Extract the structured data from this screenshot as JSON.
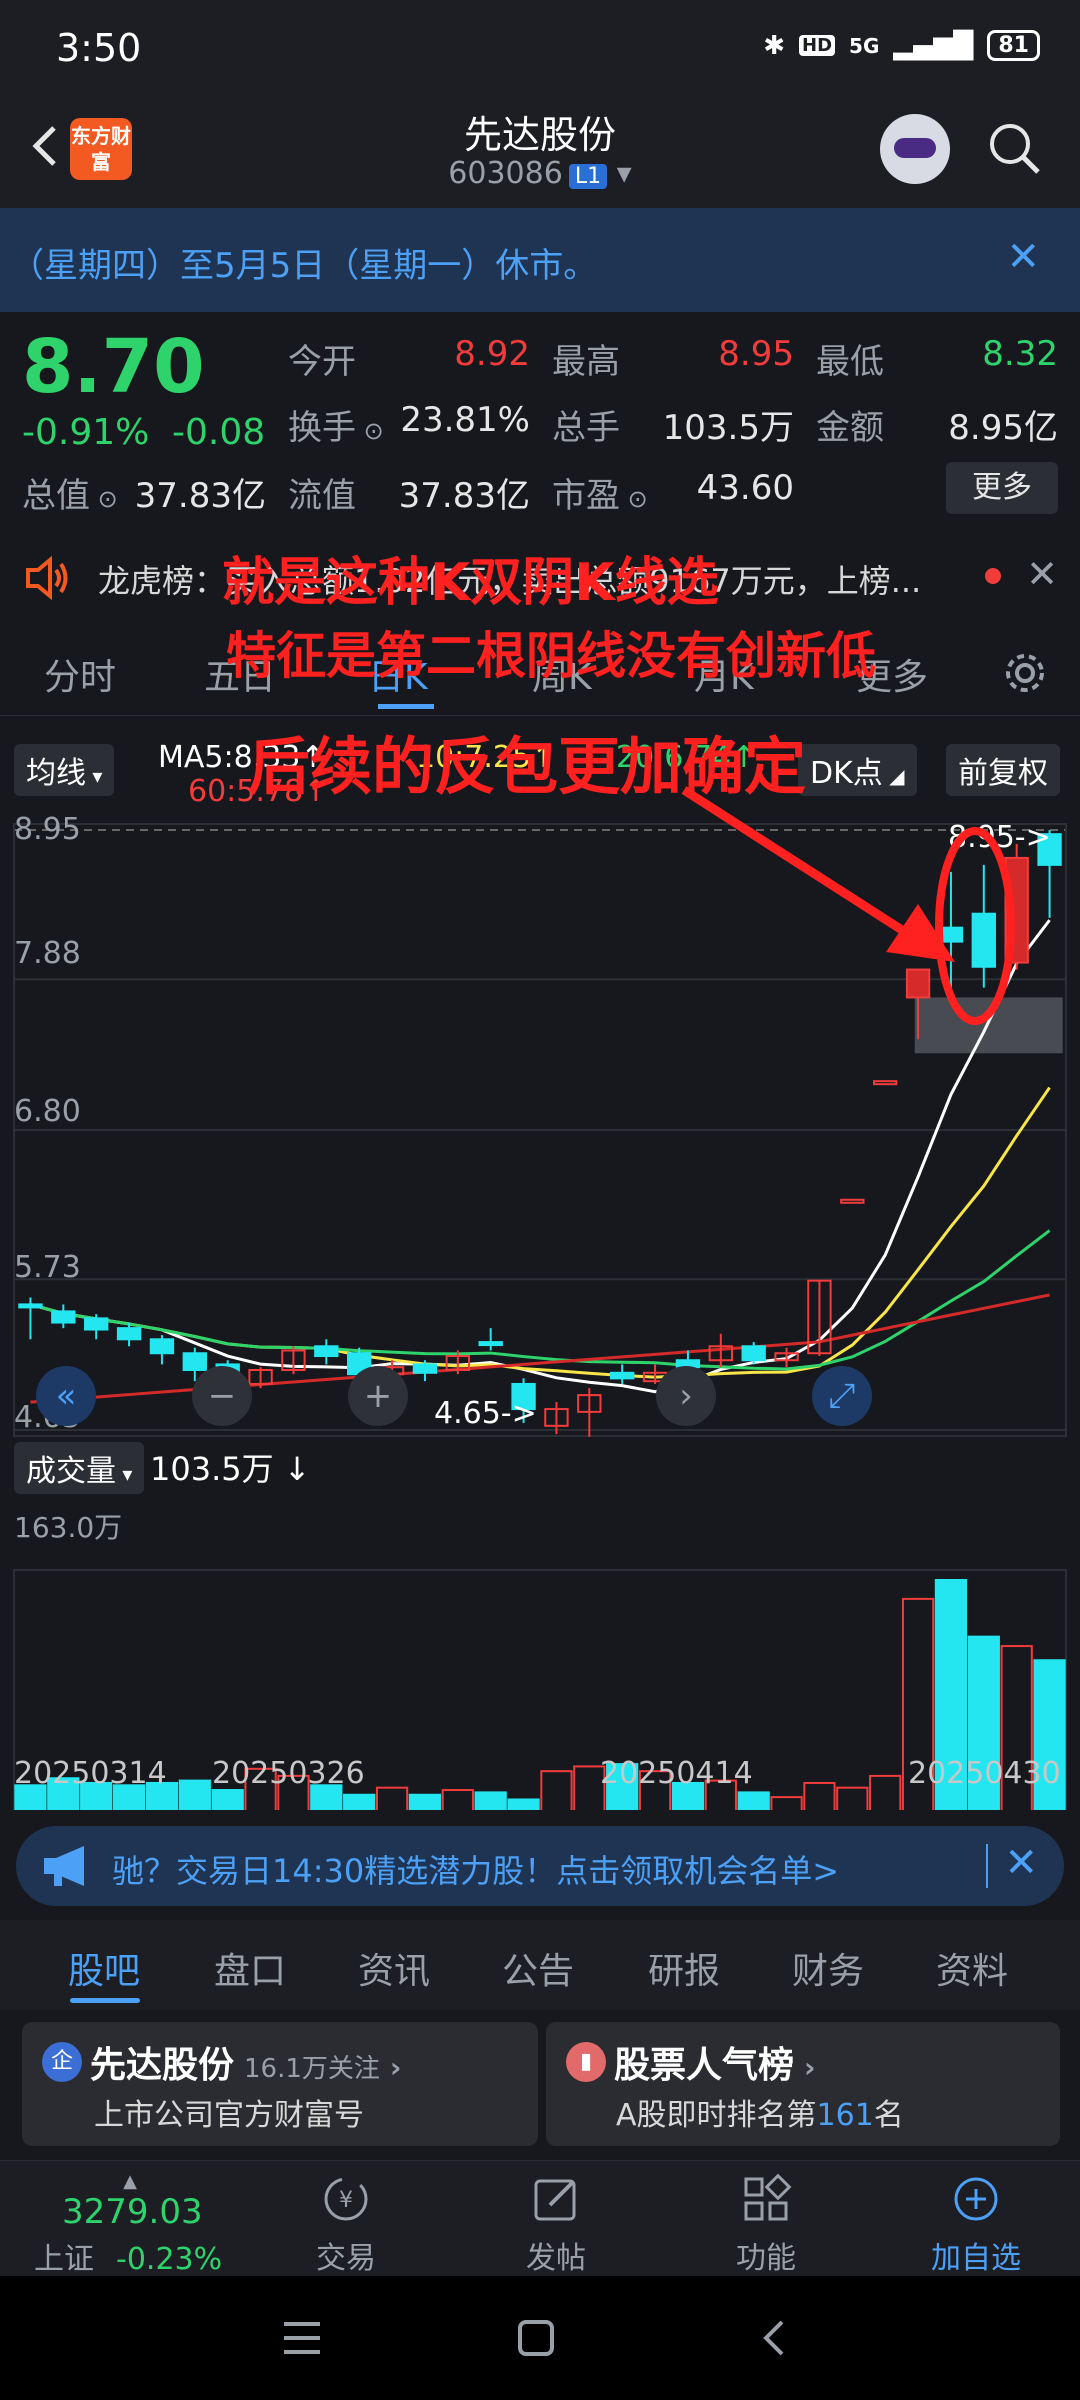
{
  "status": {
    "time": "3:50",
    "hd": "HD",
    "signal": "5G",
    "battery": "81"
  },
  "header": {
    "logo": "东方财富",
    "title": "先达股份",
    "code": "603086",
    "level": "L1"
  },
  "notice": {
    "text": "（星期四）至5月5日（星期一）休市。",
    "close": "✕"
  },
  "quote": {
    "price": "8.70",
    "pct": "-0.91%",
    "chg": "-0.08",
    "rows": [
      [
        {
          "label": "今开",
          "value": "8.92",
          "color": "red"
        },
        {
          "label": "最高",
          "value": "8.95",
          "color": "red"
        },
        {
          "label": "最低",
          "value": "8.32",
          "color": "green"
        }
      ],
      [
        {
          "label": "换手",
          "value": "23.81%",
          "color": "white"
        },
        {
          "label": "总手",
          "value": "103.5万",
          "color": "white"
        },
        {
          "label": "金额",
          "value": "8.95亿",
          "color": "white"
        }
      ],
      [
        {
          "label": "总值",
          "value": "37.83亿",
          "color": "white"
        },
        {
          "label": "流值",
          "value": "37.83亿",
          "color": "white"
        },
        {
          "label": "市盈",
          "value": "43.60",
          "color": "white"
        }
      ]
    ],
    "more": "更多"
  },
  "lhb": {
    "text": "龙虎榜：买入总额1.02亿元，卖出总额9167万元，上榜..."
  },
  "ktabs": [
    "分时",
    "五日",
    "日K",
    "周K",
    "月K",
    "更多"
  ],
  "annotations": [
    "就是这种K双阴K线选",
    "特征是第二根阴线没有创新低",
    "后续的反包更加确定"
  ],
  "chart": {
    "ma_selector": "均线",
    "ma5": "MA5:8.33↑",
    "ma10": "10:7.25↑",
    "ma20": "20:6.74↑",
    "ma60": "60:5.78↑",
    "dk": "DK点",
    "fq": "前复权",
    "y_labels": [
      "8.95",
      "7.88",
      "6.80",
      "5.73",
      "4.65"
    ],
    "high_marker": "8.95->",
    "low_marker": "4.65->",
    "vol_selector": "成交量",
    "vol_value": "103.5万 ↓",
    "vol_max": "163.0万",
    "dates": [
      "20250314",
      "20250326",
      "20250414",
      "20250430"
    ]
  },
  "chart_data": {
    "type": "candlestick",
    "y_range": [
      4.65,
      8.95
    ],
    "candles": [
      {
        "o": 5.55,
        "c": 5.55,
        "h": 5.6,
        "l": 5.3,
        "up": false
      },
      {
        "o": 5.5,
        "c": 5.42,
        "h": 5.55,
        "l": 5.38,
        "up": false
      },
      {
        "o": 5.45,
        "c": 5.37,
        "h": 5.48,
        "l": 5.3,
        "up": false
      },
      {
        "o": 5.38,
        "c": 5.3,
        "h": 5.42,
        "l": 5.25,
        "up": false
      },
      {
        "o": 5.3,
        "c": 5.2,
        "h": 5.33,
        "l": 5.12,
        "up": false
      },
      {
        "o": 5.2,
        "c": 5.08,
        "h": 5.24,
        "l": 5.0,
        "up": false
      },
      {
        "o": 5.12,
        "c": 4.95,
        "h": 5.15,
        "l": 4.85,
        "up": false
      },
      {
        "o": 4.98,
        "c": 5.08,
        "h": 5.1,
        "l": 4.95,
        "up": true
      },
      {
        "o": 5.08,
        "c": 5.22,
        "h": 5.25,
        "l": 5.05,
        "up": true
      },
      {
        "o": 5.25,
        "c": 5.18,
        "h": 5.3,
        "l": 5.12,
        "up": false
      },
      {
        "o": 5.2,
        "c": 5.05,
        "h": 5.24,
        "l": 5.0,
        "up": false
      },
      {
        "o": 5.05,
        "c": 5.1,
        "h": 5.15,
        "l": 5.0,
        "up": true
      },
      {
        "o": 5.12,
        "c": 5.06,
        "h": 5.15,
        "l": 5.0,
        "up": false
      },
      {
        "o": 5.08,
        "c": 5.18,
        "h": 5.22,
        "l": 5.05,
        "up": true
      },
      {
        "o": 5.28,
        "c": 5.28,
        "h": 5.38,
        "l": 5.22,
        "up": false
      },
      {
        "o": 4.98,
        "c": 4.8,
        "h": 5.02,
        "l": 4.7,
        "up": false
      },
      {
        "o": 4.68,
        "c": 4.8,
        "h": 4.85,
        "l": 4.62,
        "up": true
      },
      {
        "o": 4.78,
        "c": 4.9,
        "h": 4.95,
        "l": 4.6,
        "up": true
      },
      {
        "o": 5.02,
        "c": 5.06,
        "h": 5.12,
        "l": 4.98,
        "up": false
      },
      {
        "o": 5.0,
        "c": 5.06,
        "h": 5.12,
        "l": 4.98,
        "up": true
      },
      {
        "o": 5.1,
        "c": 5.15,
        "h": 5.22,
        "l": 5.05,
        "up": false
      },
      {
        "o": 5.15,
        "c": 5.25,
        "h": 5.34,
        "l": 5.1,
        "up": true
      },
      {
        "o": 5.25,
        "c": 5.15,
        "h": 5.28,
        "l": 5.12,
        "up": false
      },
      {
        "o": 5.15,
        "c": 5.2,
        "h": 5.24,
        "l": 5.1,
        "up": true
      },
      {
        "o": 5.2,
        "c": 5.72,
        "h": 5.72,
        "l": 5.18,
        "up": true
      },
      {
        "o": 6.3,
        "c": 6.3,
        "h": 6.3,
        "l": 6.3,
        "up": true
      },
      {
        "o": 7.15,
        "c": 7.15,
        "h": 7.15,
        "l": 7.15,
        "up": true
      },
      {
        "o": 7.75,
        "c": 7.95,
        "h": 7.95,
        "l": 7.45,
        "up": true
      },
      {
        "o": 8.25,
        "c": 8.15,
        "h": 8.65,
        "l": 7.8,
        "up": false
      },
      {
        "o": 8.35,
        "c": 7.97,
        "h": 8.7,
        "l": 7.82,
        "up": false
      },
      {
        "o": 8.0,
        "c": 8.75,
        "h": 8.85,
        "l": 7.95,
        "up": true
      },
      {
        "o": 8.92,
        "c": 8.7,
        "h": 8.95,
        "l": 8.32,
        "up": false
      }
    ],
    "volumes": [
      13,
      16,
      14,
      13,
      14,
      15,
      11,
      20,
      17,
      13,
      9,
      12,
      9,
      11,
      10,
      7,
      19,
      21,
      22,
      19,
      14,
      15,
      10,
      8,
      14,
      12,
      17,
      92,
      100,
      76,
      72,
      66
    ]
  },
  "ad": {
    "text": "驰？交易日14:30精选潜力股！点击领取机会名单>",
    "close": "✕"
  },
  "btabs": [
    "股吧",
    "盘口",
    "资讯",
    "公告",
    "研报",
    "财务",
    "资料"
  ],
  "cards": [
    {
      "icon": "企",
      "title": "先达股份",
      "follow": "16.1万关注",
      "sub": "上市公司官方财富号"
    },
    {
      "icon": "▮",
      "title": "股票人气榜",
      "sub_pre": "A股即时排名第",
      "rank": "161",
      "sub_post": "名"
    }
  ],
  "nav": {
    "index_value": "3279.03",
    "index_name": "上证",
    "index_pct": "-0.23%",
    "items": [
      "交易",
      "发帖",
      "功能",
      "加自选"
    ]
  }
}
